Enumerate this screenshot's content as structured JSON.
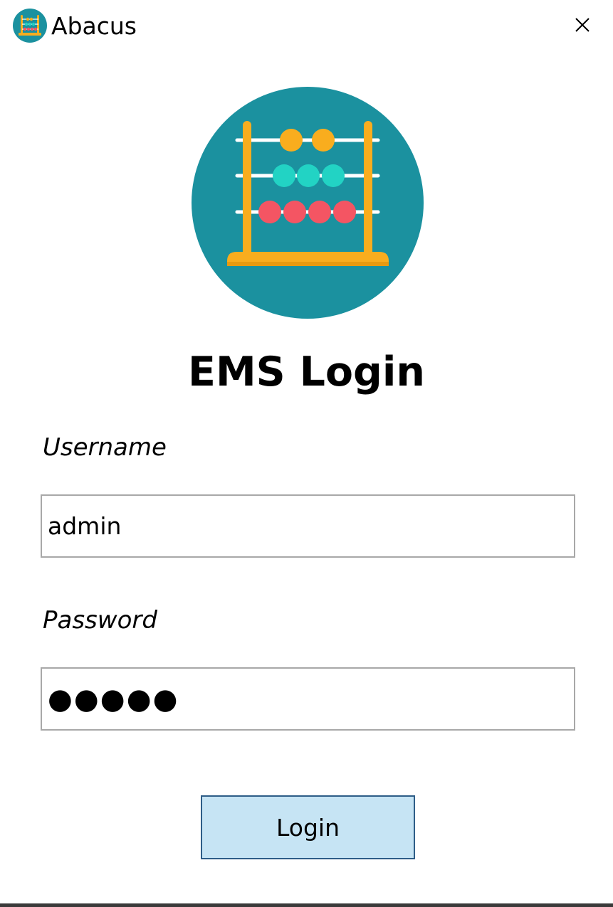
{
  "window": {
    "title": "Abacus",
    "icon": "abacus-icon",
    "close_icon": "close-icon"
  },
  "logo": {
    "icon": "abacus-logo",
    "colors": {
      "circle": "#1b919f",
      "frame": "#f9ad1e",
      "top_beads": "#f9ad1e",
      "middle_beads": "#22d3c4",
      "bottom_beads": "#f45563",
      "rods": "#ffffff"
    }
  },
  "form": {
    "heading": "EMS Login",
    "username_label": "Username",
    "username_value": "admin",
    "password_label": "Password",
    "password_value": "●●●●●",
    "login_label": "Login"
  },
  "colors": {
    "button_bg": "#c6e4f4",
    "button_border": "#2e5d87",
    "input_border": "#a8a8a8"
  }
}
